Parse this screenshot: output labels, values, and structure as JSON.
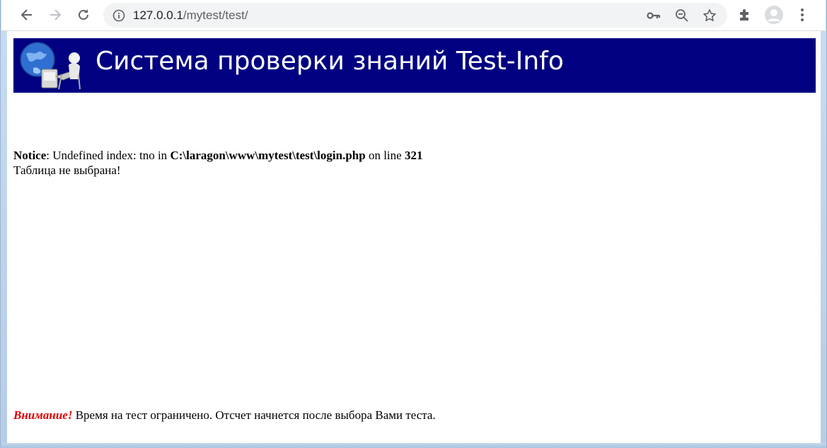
{
  "browser": {
    "url_host": "127.0.0.1",
    "url_path": "/mytest/test/"
  },
  "banner": {
    "title": "Система проверки знаний Test-Info"
  },
  "notice": {
    "label": "Notice",
    "message": ": Undefined index: tno in ",
    "file": "C:\\laragon\\www\\mytest\\test\\login.php",
    "on_line": " on line ",
    "line": "321",
    "status": "Таблица не выбрана!"
  },
  "warning": {
    "attention": "Внимание!",
    "text": " Время на тест ограничено. Отсчет начнется после выбора Вами теста."
  },
  "colors": {
    "banner_bg": "#000080",
    "attention": "#e00000"
  }
}
